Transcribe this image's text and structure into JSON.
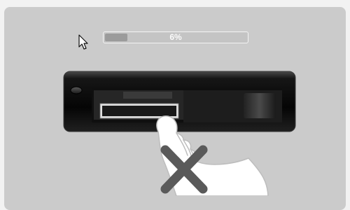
{
  "progress": {
    "text": "6%",
    "fraction": 0.06
  },
  "icons": {
    "cursor": "mouse-pointer-icon",
    "device": "card-reader-slot",
    "hand": "hand-inserting-card-illustration",
    "error": "x-mark-icon"
  },
  "colors": {
    "panel_background": "#cbcbcb",
    "x_mark": "#5a5a5a",
    "device_body": "#0a0a0a"
  }
}
